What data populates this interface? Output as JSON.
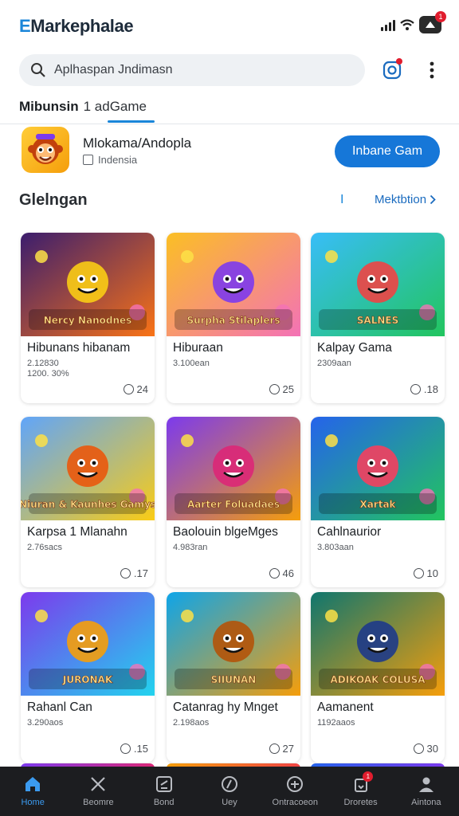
{
  "app": {
    "logo_mark": "E",
    "logo_rest": "Markephalae"
  },
  "status": {
    "notification_count": "1"
  },
  "search": {
    "placeholder": "Aplhaspan Jndimasn"
  },
  "tabs": {
    "main": "Mibunsin",
    "sub": "1 adGame"
  },
  "featured": {
    "title": "Mlokama/Andopla",
    "subtitle": "Indensia",
    "install_label": "Inbane Gam"
  },
  "section": {
    "title": "Glelngan",
    "separator": "I",
    "link_label": "Mektbtion"
  },
  "cards": [
    {
      "title": "Hibunans hibanam",
      "meta1": "2.12830",
      "meta2": "1200. 30%",
      "count": "24",
      "thumb_text": "Nercy Nanodnes"
    },
    {
      "title": "Hiburaan",
      "meta1": "3.100ean",
      "meta2": "",
      "count": "25",
      "thumb_text": "Surpha Stilaplers"
    },
    {
      "title": "Kalpay Gama",
      "meta1": "2309aan",
      "meta2": "",
      "count": ".18",
      "thumb_text": "SALNES"
    },
    {
      "title": "Karpsa 1 Mlanahn",
      "meta1": "2.76sacs",
      "meta2": "",
      "count": ".17",
      "thumb_text": "Niuran & Kaunhes Gamys"
    },
    {
      "title": "Baolouin blgeMges",
      "meta1": "4.983ran",
      "meta2": "",
      "count": "46",
      "thumb_text": "Aarter Foluadaes"
    },
    {
      "title": "Cahlnaurior",
      "meta1": "3.803aan",
      "meta2": "",
      "count": "10",
      "thumb_text": "Xartak"
    },
    {
      "title": "Rahanl Can",
      "meta1": "3.290aos",
      "meta2": "",
      "count": ".15",
      "thumb_text": "JURONAK"
    },
    {
      "title": "Catanrag hy Mnget",
      "meta1": "2.198aos",
      "meta2": "",
      "count": "27",
      "thumb_text": "SIIUNAN"
    },
    {
      "title": "Aamanent",
      "meta1": "1192aaos",
      "meta2": "",
      "count": "30",
      "thumb_text": "ADIKOAK COLUSA"
    }
  ],
  "nav": [
    {
      "label": "Home",
      "icon": "home-icon"
    },
    {
      "label": "Beomre",
      "icon": "cross-icon"
    },
    {
      "label": "Bond",
      "icon": "note-icon"
    },
    {
      "label": "Uey",
      "icon": "compass-icon"
    },
    {
      "label": "Ontracoeon",
      "icon": "circle-plus-icon"
    },
    {
      "label": "Droretes",
      "icon": "bag-icon",
      "badge": "1"
    },
    {
      "label": "Aintona",
      "icon": "person-icon"
    }
  ],
  "colors": {
    "accent": "#1677d8",
    "nav_bg": "#1c1d20",
    "badge": "#e11d2e"
  }
}
